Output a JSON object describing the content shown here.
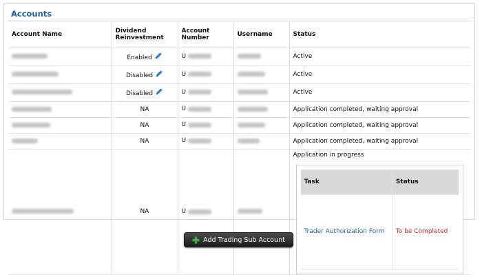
{
  "panel": {
    "title": "Accounts"
  },
  "table": {
    "headers": {
      "account_name": "Account Name",
      "dividend_reinvestment": "Dividend Reinvestment",
      "account_number": "Account Number",
      "username": "Username",
      "status": "Status"
    },
    "rows": [
      {
        "dividend": "Enabled",
        "editable": true,
        "acct_prefix": "U",
        "status": "Active"
      },
      {
        "dividend": "Disabled",
        "editable": true,
        "acct_prefix": "U",
        "status": "Active"
      },
      {
        "dividend": "Disabled",
        "editable": true,
        "acct_prefix": "U",
        "status": "Active"
      },
      {
        "dividend": "NA",
        "editable": false,
        "acct_prefix": "U",
        "status": "Application completed, waiting approval"
      },
      {
        "dividend": "NA",
        "editable": false,
        "acct_prefix": "U",
        "status": "Application completed, waiting approval"
      },
      {
        "dividend": "NA",
        "editable": false,
        "acct_prefix": "U",
        "status": "Application completed, waiting approval"
      },
      {
        "dividend": "NA",
        "editable": false,
        "acct_prefix": "U",
        "status": "Application in progress"
      }
    ],
    "task_table": {
      "headers": {
        "task": "Task",
        "status": "Status"
      },
      "rows": [
        {
          "task": "Trader Authorization Form",
          "status": "To be Completed"
        }
      ]
    }
  },
  "add_button": {
    "label": "Add Trading Sub Account",
    "icon": "plus-icon"
  },
  "colors": {
    "title": "#1f5fa8",
    "link": "#1f5fa8",
    "pending_status": "#d82020",
    "button_bg": "#2b2b2b",
    "plus_icon": "#3cb043"
  }
}
